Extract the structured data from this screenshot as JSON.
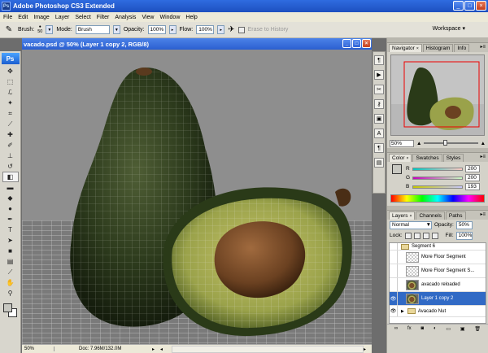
{
  "app": {
    "title": "Adobe Photoshop CS3 Extended",
    "logo": "Ps"
  },
  "window_buttons": {
    "minimize": "_",
    "maximize": "□",
    "close": "×"
  },
  "menu": [
    "File",
    "Edit",
    "Image",
    "Layer",
    "Select",
    "Filter",
    "Analysis",
    "View",
    "Window",
    "Help"
  ],
  "options": {
    "tool_icon": "eraser-icon",
    "brush_label": "Brush:",
    "brush_size": "50",
    "mode_label": "Mode:",
    "mode_value": "Brush",
    "opacity_label": "Opacity:",
    "opacity_value": "100%",
    "flow_label": "Flow:",
    "flow_value": "100%",
    "erase_history": "Erase to History",
    "workspace": "Workspace ▾"
  },
  "document": {
    "title": "vacado.psd @ 50% (Layer 1 copy 2, RGB/8)",
    "zoom": "50%",
    "doc_size": "Doc: 7.96M/132.0M"
  },
  "navigator": {
    "tabs": [
      "Navigator",
      "Histogram",
      "Info"
    ],
    "zoom": "50%"
  },
  "color": {
    "tabs": [
      "Color",
      "Swatches",
      "Styles"
    ],
    "channels": [
      {
        "name": "R",
        "value": "200"
      },
      {
        "name": "G",
        "value": "200"
      },
      {
        "name": "B",
        "value": "193"
      }
    ],
    "fg_color": "#c8c8c1"
  },
  "layers": {
    "tabs": [
      "Layers",
      "Channels",
      "Paths"
    ],
    "blend_mode": "Normal",
    "opacity_label": "Opacity:",
    "opacity": "50%",
    "lock_label": "Lock:",
    "fill_label": "Fill:",
    "fill": "100%",
    "items": [
      {
        "name": "Segment 6",
        "type": "group"
      },
      {
        "name": "More Floor Segment",
        "type": "layer"
      },
      {
        "name": "More Floor Segment S...",
        "type": "layer"
      },
      {
        "name": "avacado reloaded",
        "type": "layer"
      },
      {
        "name": "Layer 1 copy 2",
        "type": "selected"
      },
      {
        "name": "Avacado Nut",
        "type": "group"
      }
    ]
  }
}
